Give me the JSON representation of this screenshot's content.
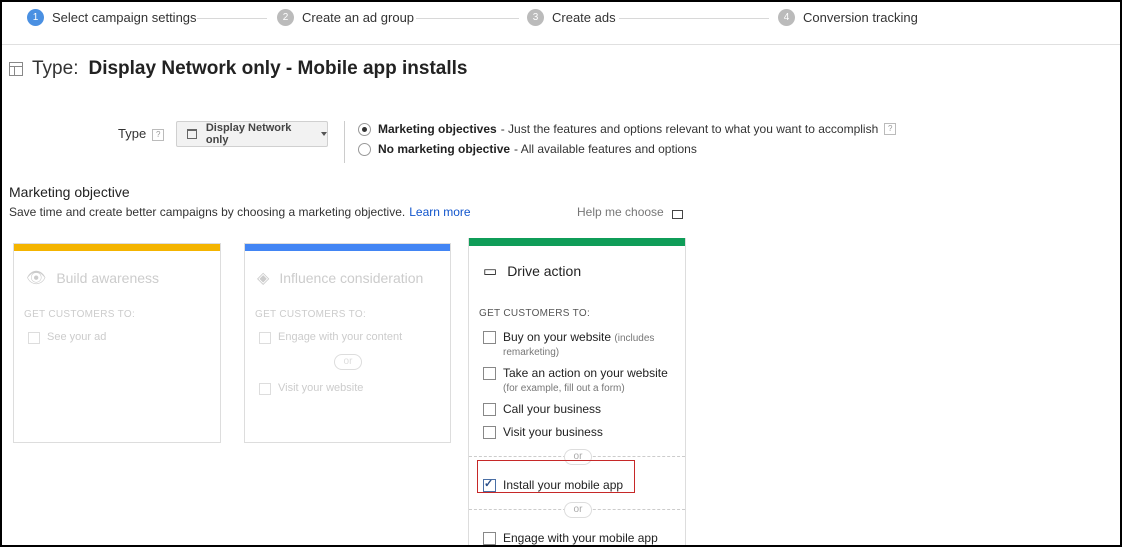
{
  "steps": [
    {
      "num": "1",
      "label": "Select campaign settings"
    },
    {
      "num": "2",
      "label": "Create an ad group"
    },
    {
      "num": "3",
      "label": "Create ads"
    },
    {
      "num": "4",
      "label": "Conversion tracking"
    }
  ],
  "header": {
    "type_label": "Type:",
    "type_value": "Display Network only - Mobile app installs"
  },
  "type_row": {
    "label": "Type",
    "help": "?",
    "dropdown_value": "Display Network only",
    "options": [
      {
        "bold": "Marketing objectives",
        "rest": "- Just the features and options relevant to what you want to accomplish",
        "selected": true
      },
      {
        "bold": "No marketing objective",
        "rest": "- All available features and options",
        "selected": false
      }
    ]
  },
  "objective": {
    "title": "Marketing objective",
    "subtitle": "Save time and create better campaigns by choosing a marketing objective.",
    "learn_more": "Learn more",
    "help_choose": "Help me choose"
  },
  "cards": {
    "awareness": {
      "title": "Build awareness",
      "icon": "eye-icon",
      "bar_color": "#f4b400",
      "get": "GET CUSTOMERS TO:",
      "items": [
        "See your ad"
      ]
    },
    "consideration": {
      "title": "Influence consideration",
      "icon": "directions-icon",
      "bar_color": "#4285f4",
      "get": "GET CUSTOMERS TO:",
      "items": [
        "Engage with your content",
        "Visit your website"
      ],
      "or": "or"
    },
    "action": {
      "title": "Drive action",
      "icon": "credit-card-icon",
      "bar_color": "#0f9d58",
      "get": "GET CUSTOMERS TO:",
      "buy": "Buy on your website",
      "buy_note": "(includes",
      "buy_note2": "remarketing)",
      "take": "Take an action on your website",
      "take_note": "(for example, fill out a form)",
      "call": "Call your business",
      "visit": "Visit your business",
      "or1": "or",
      "install": "Install your mobile app",
      "install_checked": true,
      "or2": "or",
      "engage": "Engage with your mobile app"
    }
  }
}
